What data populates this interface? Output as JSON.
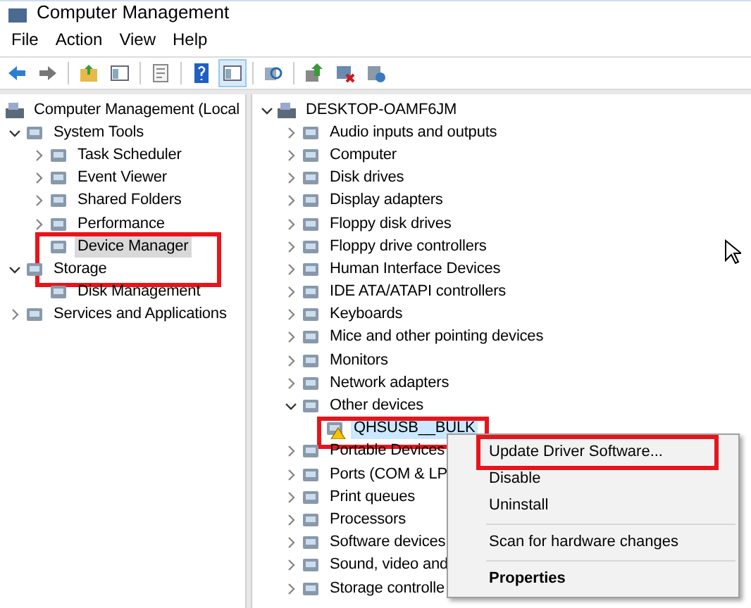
{
  "window": {
    "title": "Computer Management"
  },
  "menu": [
    "File",
    "Action",
    "View",
    "Help"
  ],
  "toolbar": {
    "buttons": [
      {
        "kind": "back"
      },
      {
        "kind": "forward"
      },
      {
        "kind": "sep"
      },
      {
        "kind": "up"
      },
      {
        "kind": "pane",
        "selected": false
      },
      {
        "kind": "sep"
      },
      {
        "kind": "doc"
      },
      {
        "kind": "sep"
      },
      {
        "kind": "help"
      },
      {
        "kind": "pane",
        "selected": true
      },
      {
        "kind": "sep"
      },
      {
        "kind": "scan"
      },
      {
        "kind": "sep"
      },
      {
        "kind": "update"
      },
      {
        "kind": "remove"
      },
      {
        "kind": "add"
      }
    ]
  },
  "left_tree": [
    {
      "label": "Computer Management (Local",
      "selected": false,
      "children": [
        {
          "label": "System Tools",
          "expanded": true,
          "selected": false,
          "children": [
            {
              "label": "Task Scheduler",
              "expanded": false,
              "selected": false
            },
            {
              "label": "Event Viewer",
              "expanded": false,
              "selected": false
            },
            {
              "label": "Shared Folders",
              "expanded": false,
              "selected": false
            },
            {
              "label": "Performance",
              "expanded": false,
              "selected": false
            },
            {
              "label": "Device Manager",
              "selected": true,
              "annotated": true
            }
          ]
        },
        {
          "label": "Storage",
          "expanded": true,
          "selected": false,
          "children": [
            {
              "label": "Disk Management",
              "selected": false
            }
          ]
        },
        {
          "label": "Services and Applications",
          "expanded": false,
          "selected": false
        }
      ]
    }
  ],
  "device_tree": [
    {
      "label": "DESKTOP-OAMF6JM",
      "expanded": true,
      "selected": false,
      "children": [
        {
          "label": "Audio inputs and outputs",
          "expanded": false,
          "selected": false
        },
        {
          "label": "Computer",
          "expanded": false,
          "selected": false
        },
        {
          "label": "Disk drives",
          "expanded": false,
          "selected": false
        },
        {
          "label": "Display adapters",
          "expanded": false,
          "selected": false
        },
        {
          "label": "Floppy disk drives",
          "expanded": false,
          "selected": false
        },
        {
          "label": "Floppy drive controllers",
          "expanded": false,
          "selected": false
        },
        {
          "label": "Human Interface Devices",
          "expanded": false,
          "selected": false
        },
        {
          "label": "IDE ATA/ATAPI controllers",
          "expanded": false,
          "selected": false
        },
        {
          "label": "Keyboards",
          "expanded": false,
          "selected": false
        },
        {
          "label": "Mice and other pointing devices",
          "expanded": false,
          "selected": false
        },
        {
          "label": "Monitors",
          "expanded": false,
          "selected": false
        },
        {
          "label": "Network adapters",
          "expanded": false,
          "selected": false
        },
        {
          "label": "Other devices",
          "expanded": true,
          "selected": false,
          "children": [
            {
              "label": "QHSUSB__BULK",
              "selected": true,
              "warning": true,
              "annotated": true
            }
          ]
        },
        {
          "label": "Portable Devices",
          "expanded": false,
          "selected": false
        },
        {
          "label": "Ports (COM & LP",
          "expanded": false,
          "selected": false
        },
        {
          "label": "Print queues",
          "expanded": false,
          "selected": false
        },
        {
          "label": "Processors",
          "expanded": false,
          "selected": false
        },
        {
          "label": "Software devices",
          "expanded": false,
          "selected": false
        },
        {
          "label": "Sound, video and",
          "expanded": false,
          "selected": false
        },
        {
          "label": "Storage controlle",
          "expanded": false,
          "selected": false
        }
      ]
    }
  ],
  "context_menu": [
    {
      "kind": "item",
      "label": "Update Driver Software...",
      "annotated": true
    },
    {
      "kind": "item",
      "label": "Disable"
    },
    {
      "kind": "item",
      "label": "Uninstall"
    },
    {
      "kind": "separator"
    },
    {
      "kind": "item",
      "label": "Scan for hardware changes"
    },
    {
      "kind": "separator"
    },
    {
      "kind": "default",
      "label": "Properties"
    }
  ]
}
